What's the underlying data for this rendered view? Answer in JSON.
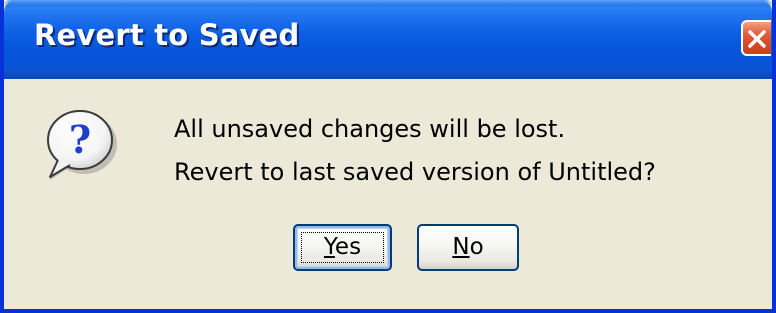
{
  "window": {
    "title": "Revert to Saved",
    "close_label": "Close"
  },
  "dialog": {
    "icon": "question-icon",
    "message_line1": "All unsaved changes will be lost.",
    "message_line2": "Revert to last saved version of Untitled?"
  },
  "buttons": {
    "yes": {
      "mnemonic": "Y",
      "rest": "es",
      "default": true
    },
    "no": {
      "mnemonic": "N",
      "rest": "o",
      "default": false
    }
  },
  "colors": {
    "titlebar": "#0a5bd8",
    "frame": "#0831d9",
    "dialog_bg": "#ece9d8",
    "close_button": "#d84b28",
    "button_border": "#003c74"
  }
}
